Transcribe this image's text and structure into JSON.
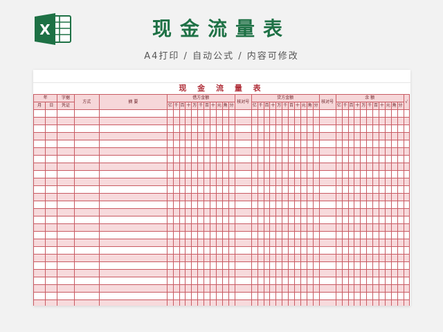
{
  "banner": {
    "title": "现金流量表",
    "subtitle": "A4打印 / 自动公式 / 内容可修改",
    "logo_letter": "X",
    "logo_color": "#1e7145"
  },
  "document": {
    "title": "现 金 流 量 表",
    "header": {
      "year": "年",
      "voucher_top": "字据",
      "month": "月",
      "day": "日",
      "voucher_bottom": "凭证",
      "method": "方式",
      "summary": "摘   要",
      "debit_amount": "借方金额",
      "check1": "核对号",
      "credit_amount": "贷方金额",
      "check2": "核对号",
      "balance": "余    额",
      "check_mark": "√"
    },
    "digit_units": [
      "亿",
      "千",
      "百",
      "十",
      "万",
      "千",
      "百",
      "十",
      "元",
      "角",
      "分"
    ],
    "row_count": 29,
    "row_colors": {
      "border": "#c85a62",
      "stripe": "#f7dadc",
      "header_bg": "#f6d7d9"
    }
  }
}
